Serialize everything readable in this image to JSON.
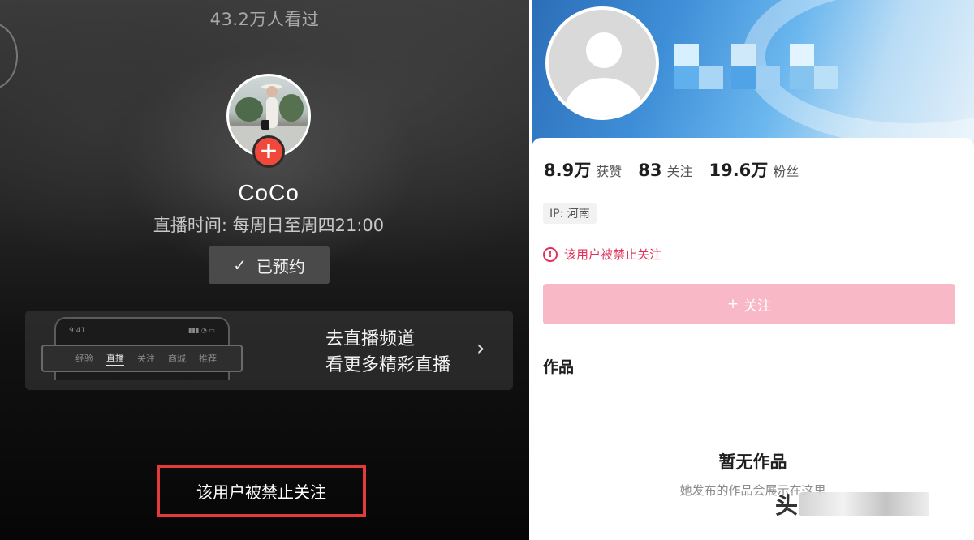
{
  "left": {
    "viewers": "43.2万人看过",
    "username": "CoCo",
    "schedule": "直播时间: 每周日至周四21:00",
    "reserved_label": "已预约",
    "channel_card": {
      "phone_time": "9:41",
      "tabs": [
        "经验",
        "直播",
        "关注",
        "商城",
        "推荐"
      ],
      "active_tab": "直播",
      "line1": "去直播频道",
      "line2": "看更多精彩直播"
    },
    "banned_message": "该用户被禁止关注"
  },
  "right": {
    "stats": [
      {
        "value": "8.9万",
        "label": "获赞"
      },
      {
        "value": "83",
        "label": "关注"
      },
      {
        "value": "19.6万",
        "label": "粉丝"
      }
    ],
    "ip": "IP: 河南",
    "ban_notice": "该用户被禁止关注",
    "follow_label": "关注",
    "works_title": "作品",
    "empty_title": "暂无作品",
    "empty_subtitle": "她发布的作品会展示在这里",
    "watermark_text": "头"
  },
  "colors": {
    "accent_red": "#f0483a",
    "ban_text": "#e0325a",
    "follow_disabled": "#f9b8c6",
    "highlight_box": "#e53a3a"
  }
}
